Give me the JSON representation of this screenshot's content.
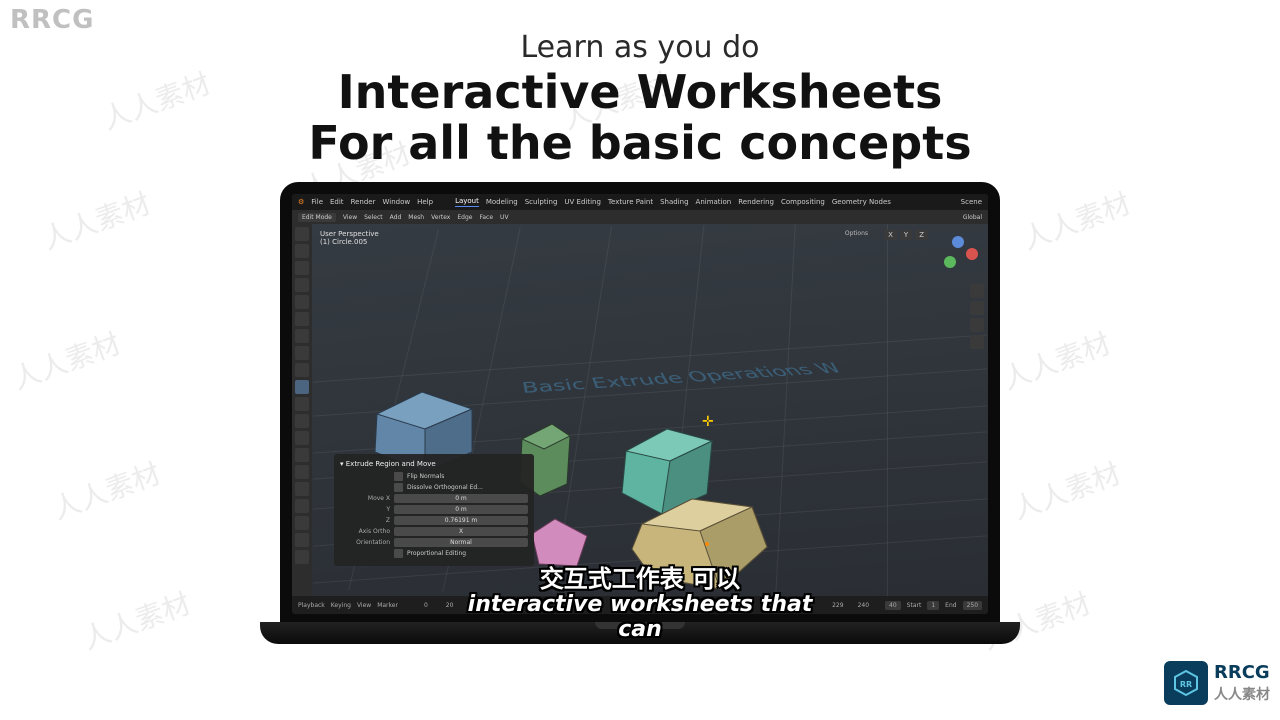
{
  "watermarks": {
    "top_left": "RRCG",
    "bottom_right_text": "人人素材",
    "scattered": "人人素材"
  },
  "heading": {
    "pretitle": "Learn as you do",
    "line1": "Interactive Worksheets",
    "line2": "For all the basic concepts"
  },
  "blender": {
    "topmenu": [
      "File",
      "Edit",
      "Render",
      "Window",
      "Help"
    ],
    "workspaces": [
      "Layout",
      "Modeling",
      "Sculpting",
      "UV Editing",
      "Texture Paint",
      "Shading",
      "Animation",
      "Rendering",
      "Compositing",
      "Geometry Nodes"
    ],
    "scene_label": "Scene",
    "header": {
      "mode": "Edit Mode",
      "items": [
        "View",
        "Select",
        "Add",
        "Mesh",
        "Vertex",
        "Edge",
        "Face",
        "UV"
      ],
      "orientation": "Global"
    },
    "viewport": {
      "label_line1": "User Perspective",
      "label_line2": "(1) Circle.005",
      "text3d": "Basic Extrude Operations W",
      "axes": [
        "X",
        "Y",
        "Z"
      ],
      "options_label": "Options"
    },
    "operator_panel": {
      "title": "Extrude Region and Move",
      "flip_normals": "Flip Normals",
      "dissolve": "Dissolve Orthogonal Ed...",
      "move_x": {
        "label": "Move X",
        "value": "0 m"
      },
      "move_y": {
        "label": "Y",
        "value": "0 m"
      },
      "move_z": {
        "label": "Z",
        "value": "0.76191 m"
      },
      "axis_ortho": {
        "label": "Axis Ortho",
        "value": "X"
      },
      "orientation": {
        "label": "Orientation",
        "value": "Normal"
      },
      "proportional": "Proportional Editing"
    },
    "timeline": {
      "left": [
        "Playback",
        "Keying",
        "View",
        "Marker"
      ],
      "start_label": "Start",
      "start_val": "1",
      "end_label": "End",
      "end_val": "250",
      "frame": "40",
      "ticks": [
        "0",
        "20",
        "40",
        "229",
        "240"
      ]
    }
  },
  "subtitles": {
    "cn": "交互式工作表 可以",
    "en": "interactive worksheets that can"
  }
}
